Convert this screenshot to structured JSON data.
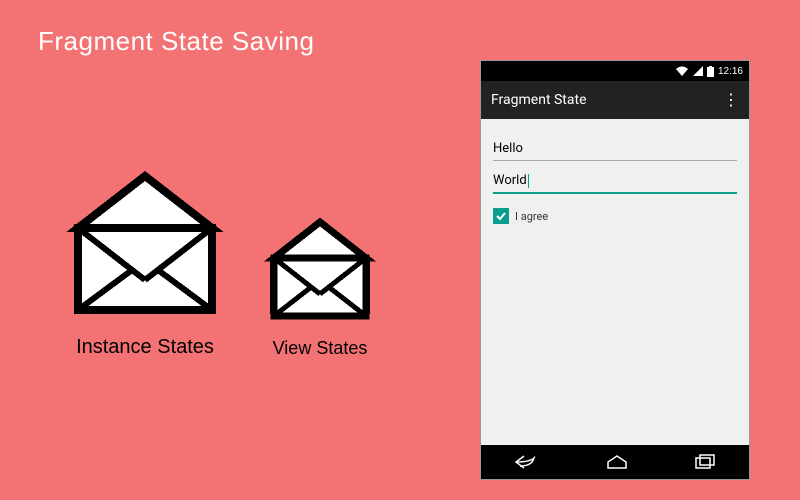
{
  "title": "Fragment State Saving",
  "envelopes": {
    "instance_label": "Instance States",
    "view_label": "View States"
  },
  "phone": {
    "status": {
      "time": "12:16"
    },
    "actionbar": {
      "title": "Fragment State"
    },
    "fields": {
      "field1_value": "Hello",
      "field2_value": "World"
    },
    "checkbox": {
      "label": "I agree",
      "checked": true
    }
  }
}
